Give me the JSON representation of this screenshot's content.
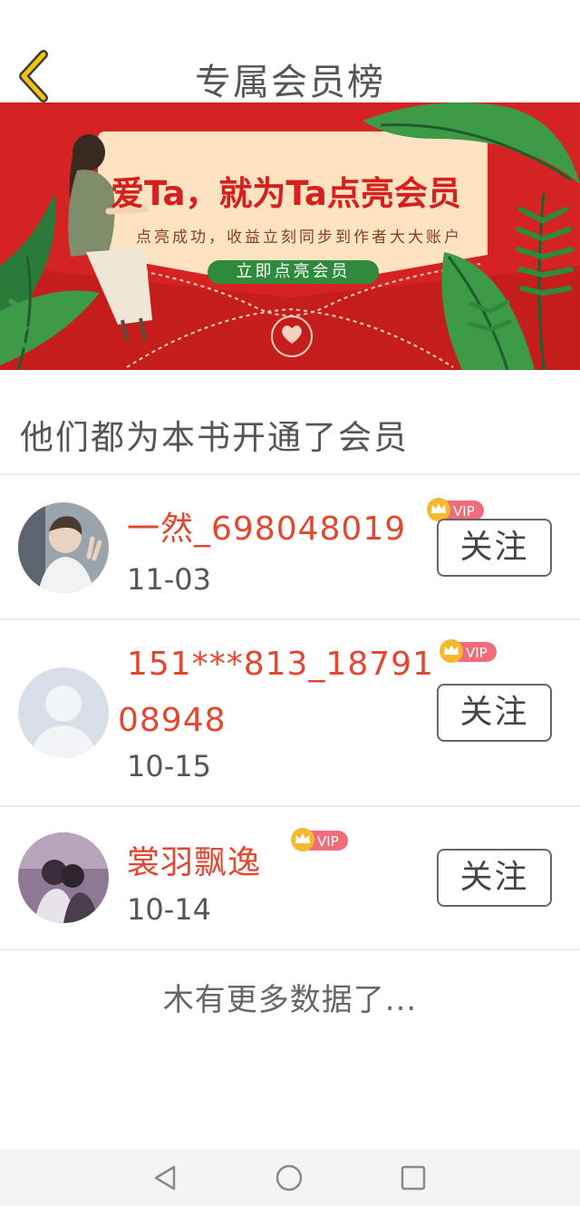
{
  "header": {
    "title": "专属会员榜",
    "back_icon": "chevron-left-icon",
    "back_color": "#f1c40f"
  },
  "banner": {
    "headline": "爱Ta，就为Ta点亮会员",
    "subline": "点亮成功，收益立刻同步到作者大大账户",
    "cta_label": "立即点亮会员",
    "bg_color": "#d42322"
  },
  "section": {
    "title": "他们都为本书开通了会员"
  },
  "members": [
    {
      "name": "一然_698048019",
      "date": "11-03",
      "badge": "VIP",
      "follow_label": "关注"
    },
    {
      "name": "151***813_1879108948",
      "date": "10-15",
      "badge": "VIP",
      "follow_label": "关注"
    },
    {
      "name": "裳羽飘逸",
      "date": "10-14",
      "badge": "VIP",
      "follow_label": "关注"
    }
  ],
  "footer": {
    "no_more": "木有更多数据了..."
  },
  "colors": {
    "name_color": "#e2472f",
    "vip_pink": "#f26b7a",
    "vip_gold": "#f5b82e"
  },
  "navbar": {
    "icons": [
      "back-triangle-icon",
      "home-circle-icon",
      "recents-square-icon"
    ]
  }
}
